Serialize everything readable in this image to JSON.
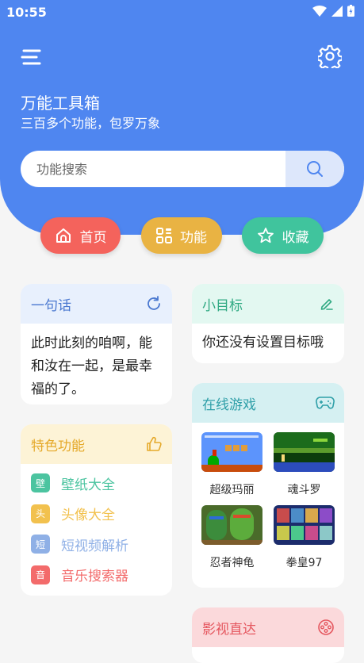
{
  "status": {
    "time": "10:55"
  },
  "header": {
    "title": "万能工具箱",
    "subtitle": "三百多个功能，包罗万象",
    "search_placeholder": "功能搜索"
  },
  "nav": [
    {
      "label": "首页",
      "color": "#f4635c",
      "icon": "home-icon"
    },
    {
      "label": "功能",
      "color": "#e9b343",
      "icon": "grid-icon"
    },
    {
      "label": "收藏",
      "color": "#40c49d",
      "icon": "star-icon"
    }
  ],
  "quote": {
    "title": "一句话",
    "text": "此时此刻的咱啊，能和汝在一起，是最幸福的了。",
    "icon": "refresh-icon"
  },
  "goal": {
    "title": "小目标",
    "text": "你还没有设置目标哦",
    "icon": "edit-icon"
  },
  "features": {
    "title": "特色功能",
    "icon": "thumbs-up-icon",
    "items": [
      {
        "badge": "壁",
        "label": "壁纸大全",
        "color": "#4cc4a0"
      },
      {
        "badge": "头",
        "label": "头像大全",
        "color": "#f2c14e"
      },
      {
        "badge": "短",
        "label": "短视频解析",
        "color": "#8fb0e6"
      },
      {
        "badge": "音",
        "label": "音乐搜索器",
        "color": "#f36b6b"
      }
    ]
  },
  "games": {
    "title": "在线游戏",
    "icon": "gamepad-icon",
    "items": [
      {
        "name": "超级玛丽"
      },
      {
        "name": "魂斗罗"
      },
      {
        "name": "忍者神龟"
      },
      {
        "name": "拳皇97"
      }
    ]
  },
  "videos": {
    "title": "影视直达",
    "icon": "film-reel-icon"
  }
}
